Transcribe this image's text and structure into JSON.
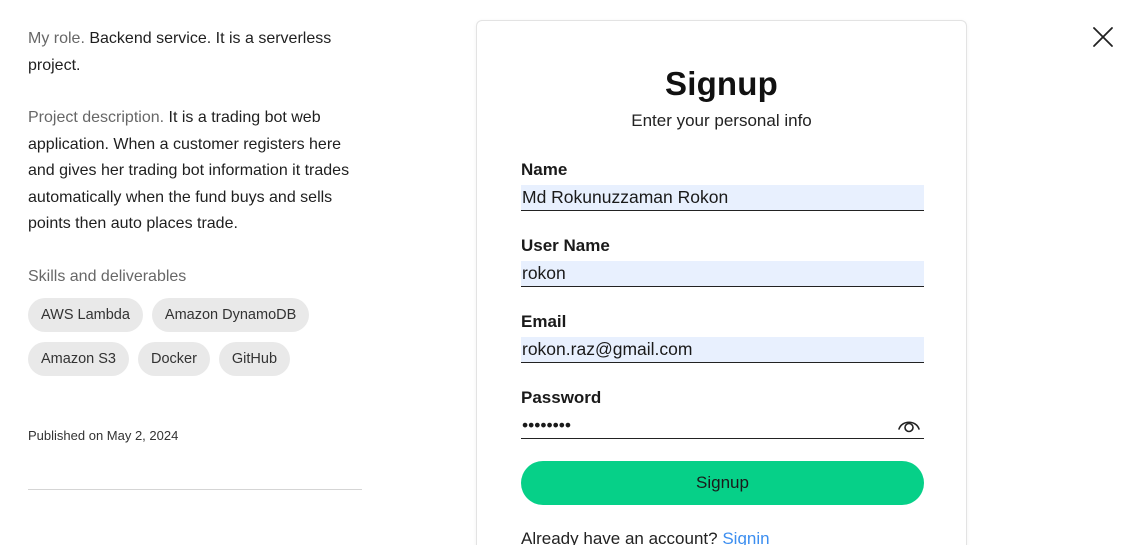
{
  "project": {
    "role_label": "My role.",
    "role_text": "Backend service. It is a serverless project.",
    "description_label": "Project description.",
    "description_text": "It is a trading bot web application. When a customer registers here and gives her trading bot information it trades automatically when the fund buys and sells points then auto places trade.",
    "skills_title": "Skills and deliverables",
    "skills": [
      "AWS Lambda",
      "Amazon DynamoDB",
      "Amazon S3",
      "Docker",
      "GitHub"
    ],
    "published": "Published on May 2, 2024"
  },
  "signup": {
    "title": "Signup",
    "subtitle": "Enter your personal info",
    "name_label": "Name",
    "name_value": "Md Rokunuzzaman Rokon",
    "username_label": "User Name",
    "username_value": "rokon",
    "email_label": "Email",
    "email_value": "rokon.raz@gmail.com",
    "password_label": "Password",
    "password_value": "12345678",
    "button_label": "Signup",
    "have_account_text": "Already have an account?",
    "signin_link": "Signin"
  },
  "icons": {
    "close": "close-icon",
    "password_toggle": "eye-icon"
  },
  "colors": {
    "accent": "#06d088",
    "link": "#3c8ef0",
    "autofill": "#e8f0fe",
    "chip_bg": "#e9e9e9"
  }
}
